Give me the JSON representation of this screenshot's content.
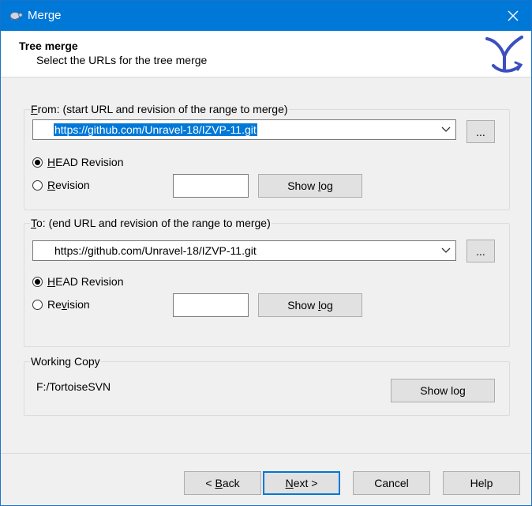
{
  "window": {
    "title": "Merge",
    "close_icon": "close-icon",
    "app_icon": "tortoise-icon"
  },
  "header": {
    "title": "Tree merge",
    "subtitle": "Select the URLs for the tree merge",
    "logo_icon": "merge-logo-icon"
  },
  "from": {
    "label_ul": "F",
    "label_rest": "rom: (start URL and revision of the range to merge)",
    "url": "https://github.com/Unravel-18/IZVP-11.git",
    "browse_label": "...",
    "head_revision": {
      "ul": "H",
      "rest": "EAD Revision",
      "checked": true
    },
    "revision": {
      "ul": "R",
      "rest": "evision",
      "checked": false,
      "value": ""
    },
    "show_log": {
      "pre": "Show ",
      "ul": "l",
      "post": "og"
    }
  },
  "to": {
    "label_ul": "T",
    "label_rest": "o: (end URL and revision of the range to merge)",
    "url": "https://github.com/Unravel-18/IZVP-11.git",
    "browse_label": "...",
    "head_revision": {
      "ul": "H",
      "rest": "EAD Revision",
      "checked": true
    },
    "revision": {
      "pre": "Re",
      "ul": "v",
      "rest": "ision",
      "checked": false,
      "value": ""
    },
    "show_log": {
      "pre": "Show ",
      "ul": "l",
      "post": "og"
    }
  },
  "working_copy": {
    "label": "Working Copy",
    "path": "F:/TortoiseSVN",
    "show_log": "Show log"
  },
  "footer": {
    "back": {
      "pre": "< ",
      "ul": "B",
      "post": "ack"
    },
    "next": {
      "ul": "N",
      "post": "ext >"
    },
    "cancel": "Cancel",
    "help": "Help"
  },
  "colors": {
    "titlebar": "#0078d7",
    "selection": "#0078d7",
    "logo": "#3b4fc0"
  }
}
